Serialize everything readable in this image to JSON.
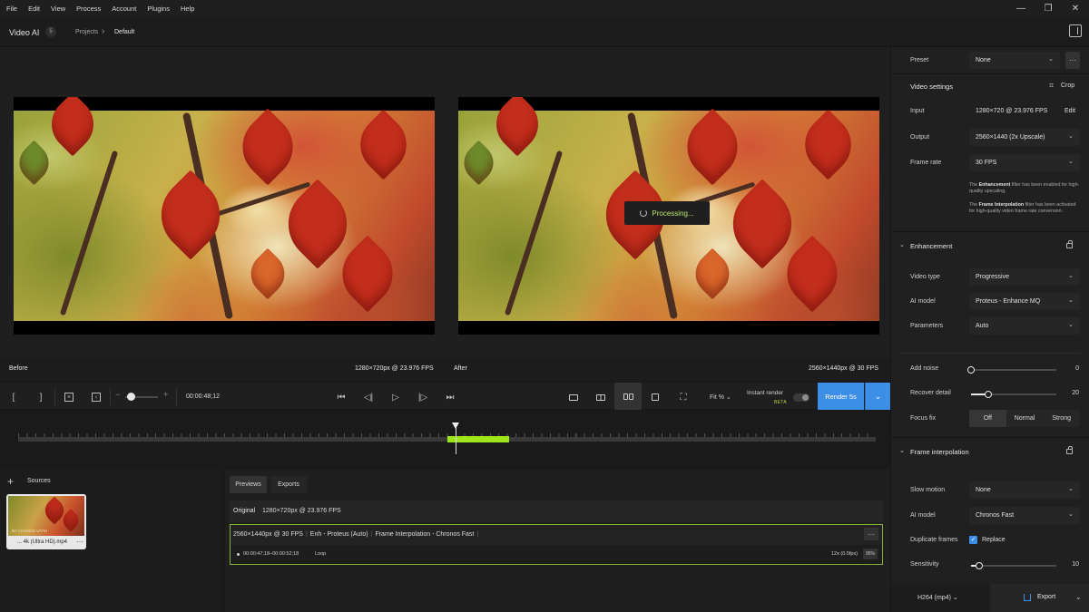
{
  "menu": [
    "File",
    "Edit",
    "View",
    "Process",
    "Account",
    "Plugins",
    "Help"
  ],
  "window": {
    "minimize": "—",
    "restore": "❐",
    "close": "✕"
  },
  "header": {
    "app_title": "Video AI",
    "badge": "5",
    "crumb_projects": "Projects",
    "crumb_sep": "›",
    "crumb_current": "Default"
  },
  "viewer": {
    "processing": "Processing...",
    "before_label": "Before",
    "before_info": "1280×720px @ 23.976 FPS",
    "after_label": "After",
    "after_info": "2560×1440px @ 30 FPS"
  },
  "controls": {
    "mark_in": "[",
    "mark_out": "]",
    "timecode": "00:00:48;12",
    "minus": "−",
    "plus": "+",
    "fit": "Fit %",
    "instant_render": "Instant render",
    "beta": "BETA",
    "render": "Render 5s",
    "render_caret": "⌄"
  },
  "timeline": {
    "playhead_fraction": 0.5,
    "range_start_fraction": 0.5,
    "range_end_fraction": 0.57
  },
  "sources": {
    "title": "Sources",
    "add": "+",
    "file_name": "... 4k (Ultra HD).mp4",
    "thumb_text": "BY CHANCE UTAH",
    "more": "···"
  },
  "previews": {
    "tabs": [
      "Previews",
      "Exports"
    ],
    "original_label": "Original",
    "original_info": "1280×720px @ 23.976 FPS",
    "output_res": "2560×1440px @ 30 FPS",
    "output_enh": "Enh - Proteus (Auto)",
    "output_fi": "Frame Interpolation - Chronos Fast",
    "range": "00:00:47;18–00:00:52;18",
    "loop": "Loop",
    "speed": "12x (0.5fps)",
    "pct": "95%",
    "more": "···"
  },
  "right": {
    "preset_label": "Preset",
    "preset_value": "None",
    "preset_more": "···",
    "video_settings": "Video settings",
    "crop": "Crop",
    "input_label": "Input",
    "input_value": "1280×720 @ 23.976 FPS",
    "input_edit": "Edit",
    "output_label": "Output",
    "output_value": "2560×1440 (2x Upscale)",
    "framerate_label": "Frame rate",
    "framerate_value": "30 FPS",
    "note1_bold": "Enhancement",
    "note1_pre": "The ",
    "note1_post": " filter has been enabled for high-quality upscaling.",
    "note2_bold": "Frame Interpolation",
    "note2_pre": "The ",
    "note2_post": " filter has been activated for high-quality video frame rate conversion.",
    "enhancement": "Enhancement",
    "video_type_label": "Video type",
    "video_type_value": "Progressive",
    "ai_model_label": "AI model",
    "ai_model_value": "Proteus - Enhance MQ",
    "parameters_label": "Parameters",
    "parameters_value": "Auto",
    "add_noise_label": "Add noise",
    "add_noise_value": "0",
    "recover_label": "Recover detail",
    "recover_value": "20",
    "focus_label": "Focus fix",
    "focus_options": [
      "Off",
      "Normal",
      "Strong"
    ],
    "frame_interp": "Frame interpolation",
    "slow_label": "Slow motion",
    "slow_value": "None",
    "fi_model_label": "AI model",
    "fi_model_value": "Chronos Fast",
    "dup_label": "Duplicate frames",
    "dup_value": "Replace",
    "sens_label": "Sensitivity",
    "sens_value": "10",
    "format": "H264 (mp4)",
    "export": "Export"
  },
  "sliders": {
    "add_noise": 0,
    "recover_detail": 0.2,
    "sensitivity": 0.1,
    "zoom": 0.15
  },
  "colors": {
    "accent": "#3d8ee6",
    "progress": "#9de619",
    "processing_text": "#b9e66a"
  }
}
